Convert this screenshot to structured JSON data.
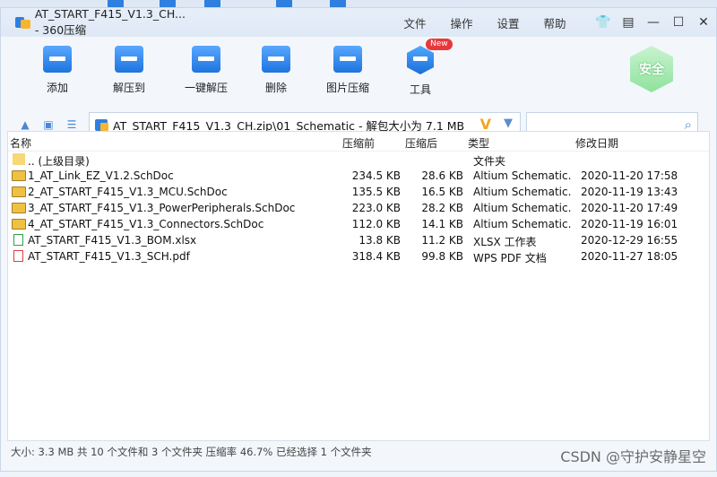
{
  "window": {
    "title": "AT_START_F415_V1.3_CH... - 360压缩"
  },
  "menu": [
    "文件",
    "操作",
    "设置",
    "帮助"
  ],
  "window_controls": [
    "shirt-icon",
    "feedback-icon",
    "minimize-icon",
    "maximize-icon",
    "close-icon"
  ],
  "toolbar": {
    "add": "添加",
    "extract_to": "解压到",
    "one_click_extract": "一键解压",
    "delete": "删除",
    "image_compress": "图片压缩",
    "tools": "工具",
    "new_badge": "New",
    "safe": "安全"
  },
  "address": {
    "path": "AT_START_F415_V1.3_CH.zip\\01_Schematic - 解包大小为 7.1 MB",
    "search_placeholder": ""
  },
  "columns": {
    "name": "名称",
    "orig_size": "压缩前",
    "comp_size": "压缩后",
    "type": "类型",
    "date": "修改日期"
  },
  "files": [
    {
      "icon": "folder-icon",
      "name": ".. (上级目录)",
      "orig": "",
      "comp": "",
      "type": "文件夹",
      "date": ""
    },
    {
      "icon": "schdoc-icon",
      "name": "1_AT_Link_EZ_V1.2.SchDoc",
      "orig": "234.5 KB",
      "comp": "28.6 KB",
      "type": "Altium Schematic...",
      "date": "2020-11-20 17:58"
    },
    {
      "icon": "schdoc-icon",
      "name": "2_AT_START_F415_V1.3_MCU.SchDoc",
      "orig": "135.5 KB",
      "comp": "16.5 KB",
      "type": "Altium Schematic...",
      "date": "2020-11-19 13:43"
    },
    {
      "icon": "schdoc-icon",
      "name": "3_AT_START_F415_V1.3_PowerPeripherals.SchDoc",
      "orig": "223.0 KB",
      "comp": "28.2 KB",
      "type": "Altium Schematic...",
      "date": "2020-11-20 17:49"
    },
    {
      "icon": "schdoc-icon",
      "name": "4_AT_START_F415_V1.3_Connectors.SchDoc",
      "orig": "112.0 KB",
      "comp": "14.1 KB",
      "type": "Altium Schematic...",
      "date": "2020-11-19 16:01"
    },
    {
      "icon": "xlsx-icon",
      "name": "AT_START_F415_V1.3_BOM.xlsx",
      "orig": "13.8 KB",
      "comp": "11.2 KB",
      "type": "XLSX 工作表",
      "date": "2020-12-29 16:55"
    },
    {
      "icon": "pdf-icon",
      "name": "AT_START_F415_V1.3_SCH.pdf",
      "orig": "318.4 KB",
      "comp": "99.8 KB",
      "type": "WPS PDF 文档",
      "date": "2020-11-27 18:05"
    }
  ],
  "status": "大小: 3.3 MB 共 10 个文件和 3 个文件夹 压缩率 46.7% 已经选择 1 个文件夹",
  "watermark": "CSDN @守护安静星空"
}
